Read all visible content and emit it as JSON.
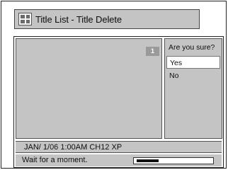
{
  "window": {
    "title": "Title List - Title Delete",
    "icon": "title-list-icon"
  },
  "preview": {
    "title_number": "1"
  },
  "confirm": {
    "question": "Are you sure?",
    "options": [
      {
        "label": "Yes",
        "selected": true
      },
      {
        "label": "No",
        "selected": false
      }
    ]
  },
  "info": {
    "recording": "JAN/ 1/06 1:00AM CH12 XP"
  },
  "status": {
    "message": "Wait for a moment.",
    "progress_fraction": 0.3
  }
}
